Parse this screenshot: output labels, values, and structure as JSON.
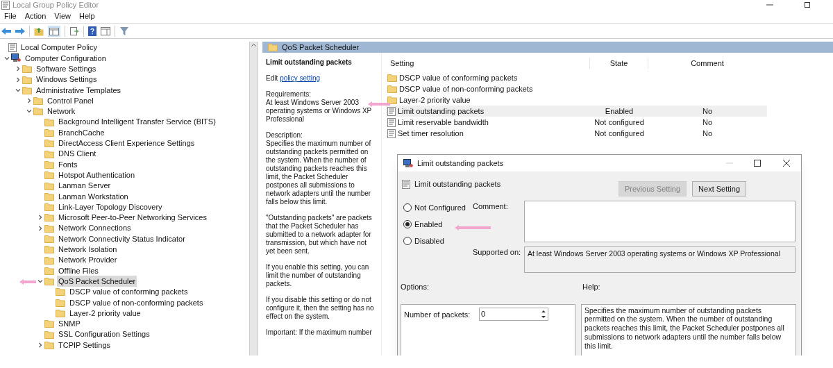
{
  "window": {
    "title": "Local Group Policy Editor"
  },
  "menu": [
    "File",
    "Action",
    "View",
    "Help"
  ],
  "tree": [
    {
      "label": "Local Computer Policy",
      "kind": "policy",
      "selected": false,
      "children": [
        {
          "label": "Computer Configuration",
          "kind": "computer",
          "expanded": true,
          "selected": false,
          "children": [
            {
              "label": "Software Settings",
              "kind": "folder",
              "expanded": false,
              "selected": false
            },
            {
              "label": "Windows Settings",
              "kind": "folder",
              "expanded": false,
              "selected": false
            },
            {
              "label": "Administrative Templates",
              "kind": "folder",
              "expanded": true,
              "selected": false,
              "children": [
                {
                  "label": "Control Panel",
                  "kind": "folder",
                  "expanded": false,
                  "selected": false
                },
                {
                  "label": "Network",
                  "kind": "folder",
                  "expanded": true,
                  "selected": false,
                  "children": [
                    {
                      "label": "Background Intelligent Transfer Service (BITS)",
                      "kind": "folder",
                      "selected": false
                    },
                    {
                      "label": "BranchCache",
                      "kind": "folder",
                      "selected": false
                    },
                    {
                      "label": "DirectAccess Client Experience Settings",
                      "kind": "folder",
                      "selected": false
                    },
                    {
                      "label": "DNS Client",
                      "kind": "folder",
                      "selected": false
                    },
                    {
                      "label": "Fonts",
                      "kind": "folder",
                      "selected": false
                    },
                    {
                      "label": "Hotspot Authentication",
                      "kind": "folder",
                      "selected": false
                    },
                    {
                      "label": "Lanman Server",
                      "kind": "folder",
                      "selected": false
                    },
                    {
                      "label": "Lanman Workstation",
                      "kind": "folder",
                      "selected": false
                    },
                    {
                      "label": "Link-Layer Topology Discovery",
                      "kind": "folder",
                      "selected": false
                    },
                    {
                      "label": "Microsoft Peer-to-Peer Networking Services",
                      "kind": "folder",
                      "expanded": false,
                      "selected": false
                    },
                    {
                      "label": "Network Connections",
                      "kind": "folder",
                      "expanded": false,
                      "selected": false
                    },
                    {
                      "label": "Network Connectivity Status Indicator",
                      "kind": "folder",
                      "selected": false
                    },
                    {
                      "label": "Network Isolation",
                      "kind": "folder",
                      "selected": false
                    },
                    {
                      "label": "Network Provider",
                      "kind": "folder",
                      "selected": false
                    },
                    {
                      "label": "Offline Files",
                      "kind": "folder",
                      "selected": false
                    },
                    {
                      "label": "QoS Packet Scheduler",
                      "kind": "folder",
                      "expanded": true,
                      "selected": true,
                      "children": [
                        {
                          "label": "DSCP value of conforming packets",
                          "kind": "folder",
                          "selected": false
                        },
                        {
                          "label": "DSCP value of non-conforming packets",
                          "kind": "folder",
                          "selected": false
                        },
                        {
                          "label": "Layer-2 priority value",
                          "kind": "folder",
                          "selected": false
                        }
                      ]
                    },
                    {
                      "label": "SNMP",
                      "kind": "folder",
                      "selected": false
                    },
                    {
                      "label": "SSL Configuration Settings",
                      "kind": "folder",
                      "selected": false
                    },
                    {
                      "label": "TCPIP Settings",
                      "kind": "folder",
                      "expanded": false,
                      "selected": false
                    }
                  ]
                }
              ]
            }
          ]
        }
      ]
    }
  ],
  "pane_header": "QoS Packet Scheduler",
  "description": {
    "title": "Limit outstanding packets",
    "edit_prefix": "Edit",
    "edit_link": "policy setting",
    "paragraphs": [
      "Requirements:\nAt least Windows Server 2003 operating systems or Windows XP Professional",
      "Description:\nSpecifies the maximum number of outstanding packets permitted on the system. When the number of outstanding packets reaches this limit, the Packet Scheduler postpones all submissions to network adapters until the number falls below this limit.",
      "\"Outstanding packets\" are packets that the Packet Scheduler has submitted to a network adapter for transmission, but which have not yet been sent.",
      "If you enable this setting, you can limit the number of outstanding packets.",
      "If you disable this setting or do not configure it, then the setting has no effect on the system.",
      "Important: If the maximum number"
    ]
  },
  "settings_table": {
    "columns": [
      "Setting",
      "State",
      "Comment"
    ],
    "rows": [
      {
        "kind": "folder",
        "name": "DSCP value of conforming packets",
        "selected": false
      },
      {
        "kind": "folder",
        "name": "DSCP value of non-conforming packets",
        "selected": false
      },
      {
        "kind": "folder",
        "name": "Layer-2 priority value",
        "selected": false
      },
      {
        "kind": "policy",
        "name": "Limit outstanding packets",
        "state": "Enabled",
        "comment": "No",
        "selected": true
      },
      {
        "kind": "policy",
        "name": "Limit reservable bandwidth",
        "state": "Not configured",
        "comment": "No",
        "selected": false
      },
      {
        "kind": "policy",
        "name": "Set timer resolution",
        "state": "Not configured",
        "comment": "No",
        "selected": false
      }
    ]
  },
  "dialog": {
    "title": "Limit outstanding packets",
    "setting_name": "Limit outstanding packets",
    "buttons": [
      {
        "label": "Previous Setting",
        "disabled": true
      },
      {
        "label": "Next Setting",
        "disabled": false
      }
    ],
    "options": [
      {
        "label": "Not Configured",
        "selected": false
      },
      {
        "label": "Enabled",
        "selected": true
      },
      {
        "label": "Disabled",
        "selected": false
      }
    ],
    "comment_label": "Comment:",
    "supported_label": "Supported on:",
    "supported_text": "At least Windows Server 2003 operating systems or Windows XP Professional",
    "options_label": "Options:",
    "help_label": "Help:",
    "packets_label": "Number of packets:",
    "packets_value": "0",
    "help_text": "Specifies the maximum number of outstanding packets permitted on the system. When the number of outstanding packets reaches this limit, the Packet Scheduler postpones all submissions to network adapters until the number falls below this limit."
  }
}
